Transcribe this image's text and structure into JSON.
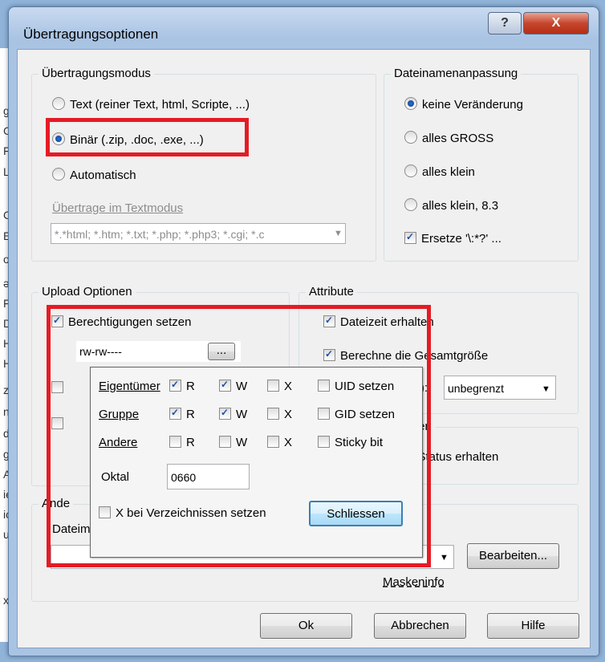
{
  "window": {
    "title": "Übertragungsoptionen",
    "help_label": "?",
    "close_label": "X"
  },
  "background_letters": [
    "g",
    "C",
    "F",
    "L",
    "C",
    "E",
    "o",
    "ən",
    "F",
    "D",
    "H",
    "H",
    "z",
    "ne",
    "d",
    "g",
    "A",
    "ie",
    "ic",
    "u",
    "x"
  ],
  "transfer_mode": {
    "title": "Übertragungsmodus",
    "options": [
      "Text (reiner Text, html, Scripte, ...)",
      "Binär (.zip, .doc, .exe, ...)",
      "Automatisch"
    ],
    "selected": 1,
    "textmode_label": "Übertrage im Textmodus",
    "textmode_value": "*.*html; *.htm; *.txt; *.php; *.php3; *.cgi; *.c"
  },
  "filename": {
    "title": "Dateinamenanpassung",
    "options": [
      "keine Veränderung",
      "alles GROSS",
      "alles klein",
      "alles klein, 8.3"
    ],
    "selected": 0,
    "replace_label": "Ersetze '\\:*?' ..."
  },
  "upload": {
    "title": "Upload Optionen",
    "permissions_label": "Berechtigungen setzen",
    "permissions_value": "rw-rw----",
    "browse_label": "..."
  },
  "attributes": {
    "title": "Attribute",
    "keep_time_label": "Dateizeit erhalten",
    "calc_size_label": "Berechne die Gesamtgröße",
    "partial_label": "Bis):",
    "limit_value": "unbegrenzt",
    "sub_title": "tionen",
    "sub_item": "er Status erhalten"
  },
  "permissions_popup": {
    "rows": [
      {
        "label": "Eigentümer",
        "r": true,
        "w": true,
        "x": false,
        "extra": "UID setzen"
      },
      {
        "label": "Gruppe",
        "r": true,
        "w": true,
        "x": false,
        "extra": "GID setzen"
      },
      {
        "label": "Andere",
        "r": false,
        "w": false,
        "x": false,
        "extra": "Sticky bit"
      }
    ],
    "col_r": "R",
    "col_w": "W",
    "col_x": "X",
    "octal_label": "Oktal",
    "octal_value": "0660",
    "dir_x_label": "X bei Verzeichnissen setzen",
    "close_button": "Schliessen"
  },
  "mask": {
    "title": "Ande",
    "label": "Dateimaske:",
    "value": "",
    "edit_button": "Bearbeiten...",
    "info_link": "Maskeninfo"
  },
  "buttons": {
    "ok": "Ok",
    "cancel": "Abbrechen",
    "help": "Hilfe"
  },
  "colors": {
    "highlight": "#e51b24",
    "title_close": "#c7462d"
  }
}
